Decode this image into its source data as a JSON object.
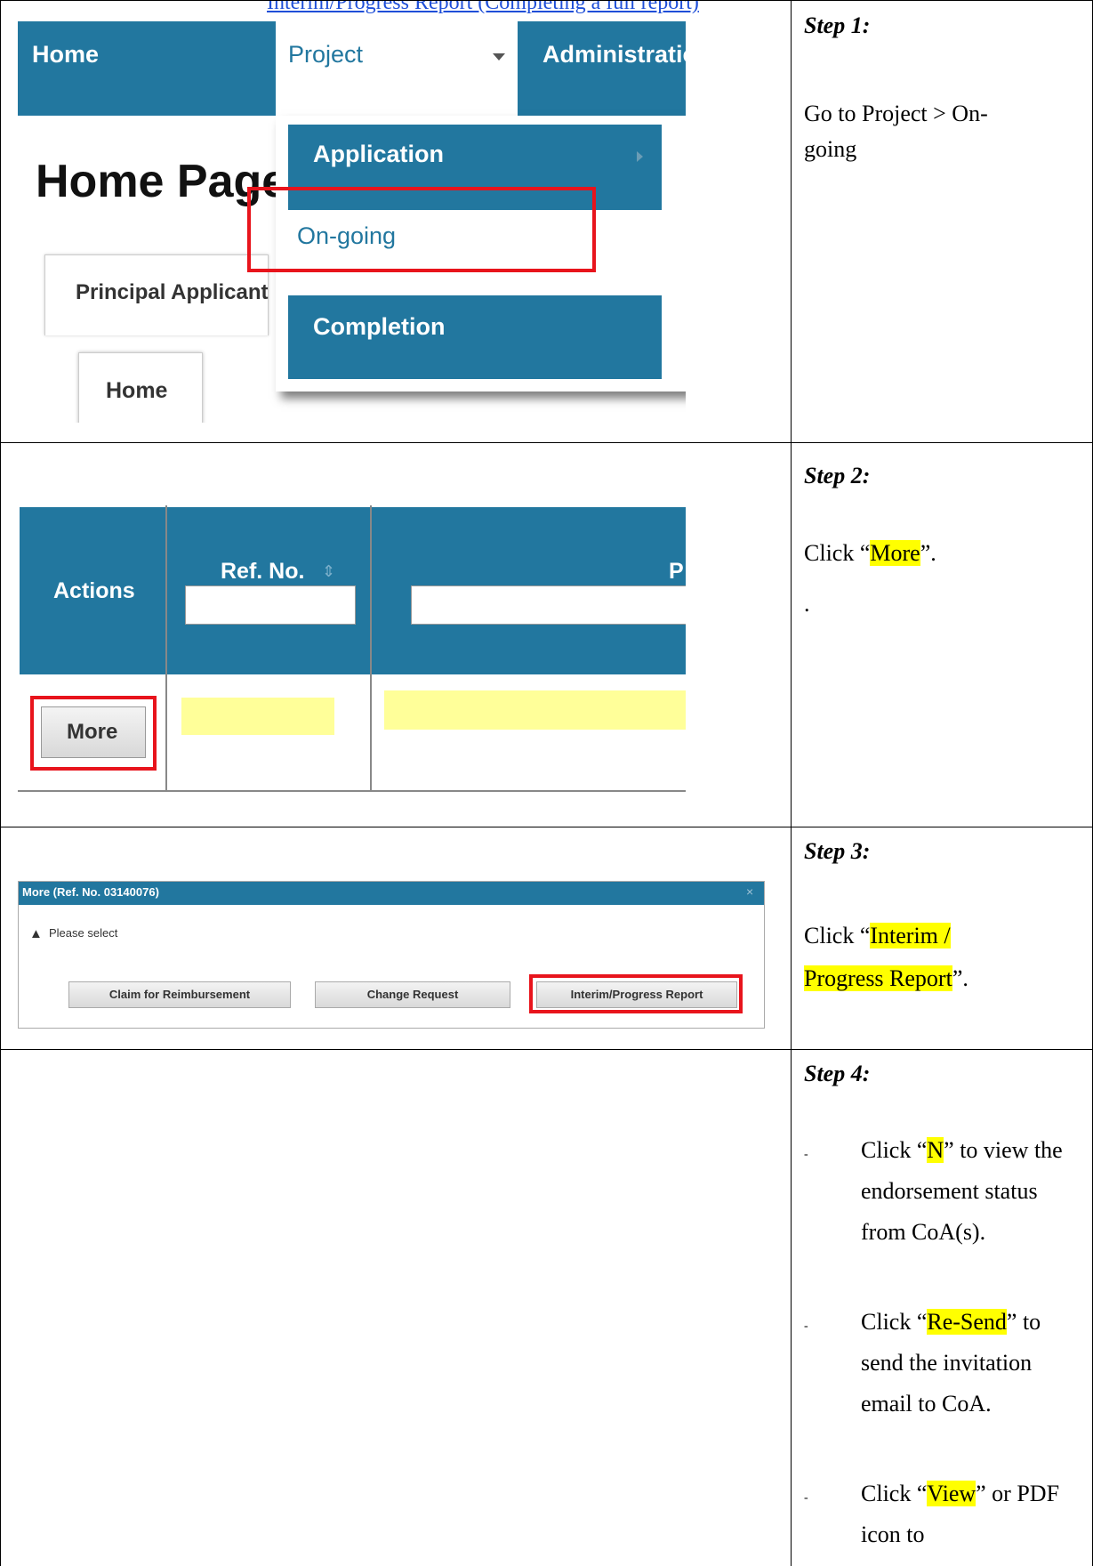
{
  "doc": {
    "top_link": "Interim/Progress Report (Completing a full report)"
  },
  "steps": [
    {
      "title": "Step 1:",
      "text": "Go to Project > On-going"
    },
    {
      "title": "Step 2:",
      "pre": "Click “",
      "highlight": "More",
      "post": "”.",
      "extra": "."
    },
    {
      "title": "Step 3:",
      "pre": "Click “",
      "highlight1": "Interim /",
      "highlight2": "Progress Report",
      "post": "”."
    },
    {
      "title": "Step 4:",
      "bullets": [
        {
          "mark": "-",
          "pre": "Click “",
          "highlight": "N",
          "post": "” to view the endorsement status from CoA(s)."
        },
        {
          "mark": "-",
          "pre": "Click “",
          "highlight": "Re-Send",
          "post": "” to send the invitation email to CoA."
        },
        {
          "mark": "-",
          "pre": "Click “",
          "highlight": "View",
          "post": "” or PDF icon to"
        }
      ]
    }
  ],
  "screen1": {
    "nav": {
      "home": "Home",
      "project": "Project",
      "admin": "Administration"
    },
    "heading": "Home Page",
    "tab_principal": "Principal Applicant",
    "tab_home": "Home",
    "dropdown": {
      "application": "Application",
      "ongoing": "On-going",
      "completion": "Completion"
    }
  },
  "screen2": {
    "headers": {
      "actions": "Actions",
      "ref": "Ref. No.",
      "p": "P"
    },
    "more": "More"
  },
  "screen3": {
    "title": "More (Ref. No. 03140076)",
    "close": "×",
    "prompt": "Please select",
    "buttons": {
      "claim": "Claim for Reimbursement",
      "change": "Change Request",
      "interim": "Interim/Progress Report"
    }
  },
  "colors": {
    "nav_blue": "#22779f",
    "highlight": "#ffff00",
    "red_outline": "#e8141c"
  }
}
